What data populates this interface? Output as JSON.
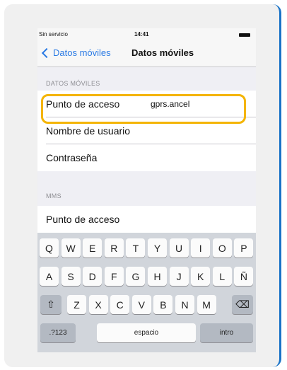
{
  "status_bar": {
    "carrier": "Sin servicio",
    "time": "14:41"
  },
  "nav": {
    "back_label": "Datos móviles",
    "title": "Datos móviles"
  },
  "section_datos": {
    "header": "DATOS MÓVILES",
    "rows": [
      {
        "label": "Punto de acceso",
        "value": "gprs.ancel"
      },
      {
        "label": "Nombre de usuario",
        "value": ""
      },
      {
        "label": "Contraseña",
        "value": ""
      }
    ]
  },
  "section_mms": {
    "header": "MMS",
    "rows": [
      {
        "label": "Punto de acceso",
        "value": ""
      }
    ]
  },
  "keyboard": {
    "row1": [
      "Q",
      "W",
      "E",
      "R",
      "T",
      "Y",
      "U",
      "I",
      "O",
      "P"
    ],
    "row2": [
      "A",
      "S",
      "D",
      "F",
      "G",
      "H",
      "J",
      "K",
      "L",
      "Ñ"
    ],
    "row3": [
      "Z",
      "X",
      "C",
      "V",
      "B",
      "N",
      "M"
    ],
    "numbers_label": ".?123",
    "space_label": "espacio",
    "return_label": "intro"
  },
  "colors": {
    "accent": "#2a7ae4",
    "highlight": "#f4b400",
    "frame_edge": "#1a73c7"
  }
}
